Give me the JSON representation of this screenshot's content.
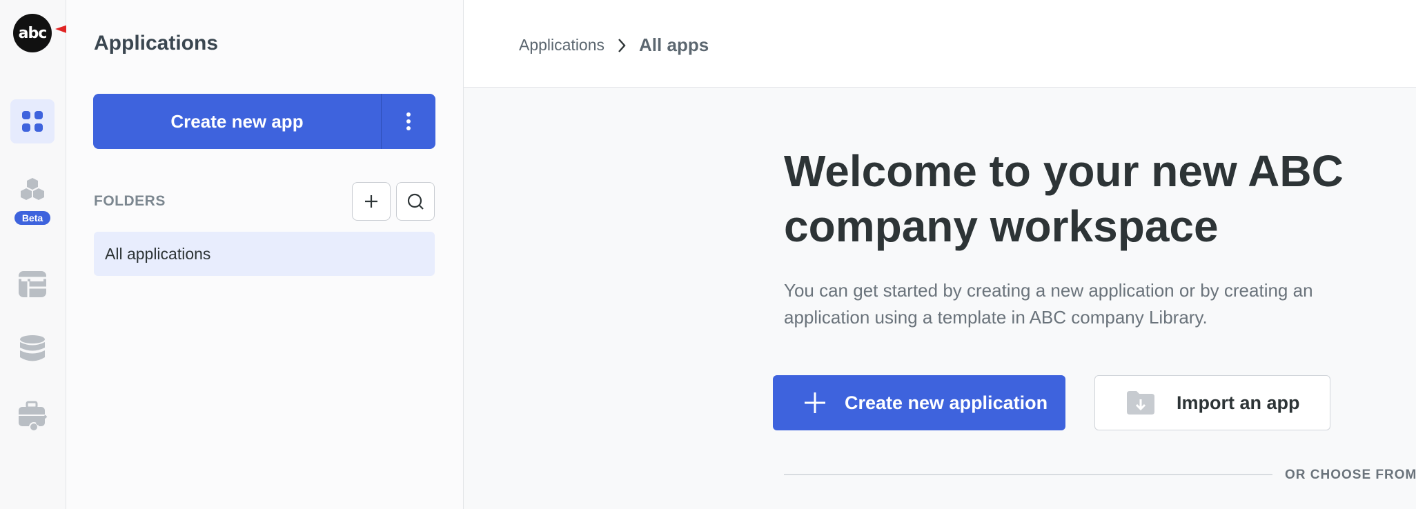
{
  "brand": {
    "logo_text": "abc"
  },
  "rail": {
    "items": [
      {
        "icon": "apps-grid-icon",
        "active": true
      },
      {
        "icon": "cubes-icon",
        "badge": "Beta"
      },
      {
        "icon": "table-icon"
      },
      {
        "icon": "database-icon"
      },
      {
        "icon": "toolbox-icon"
      }
    ]
  },
  "sidebar": {
    "title": "Applications",
    "create_button": {
      "label": "Create new app",
      "more_icon": "vertical-dots-icon"
    },
    "folders_label": "FOLDERS",
    "folder_add_icon": "plus-icon",
    "folder_search_icon": "search-icon",
    "folders": [
      {
        "label": "All applications",
        "selected": true
      }
    ]
  },
  "header": {
    "breadcrumb": [
      "Applications",
      "All apps"
    ],
    "separator_icon": "chevron-right-icon"
  },
  "welcome": {
    "title": "Welcome to your new ABC company workspace",
    "description": "You can get started by creating a new application or by creating an application using a template in ABC company Library.",
    "primary_button": {
      "label": "Create new application",
      "icon": "plus-icon"
    },
    "secondary_button": {
      "label": "Import an app",
      "icon": "folder-download-icon"
    },
    "choose_label": "OR CHOOSE FROM"
  },
  "colors": {
    "accent": "#3e63dd",
    "accent_light": "#e8edfd",
    "annotation_arrow": "#e02424"
  }
}
